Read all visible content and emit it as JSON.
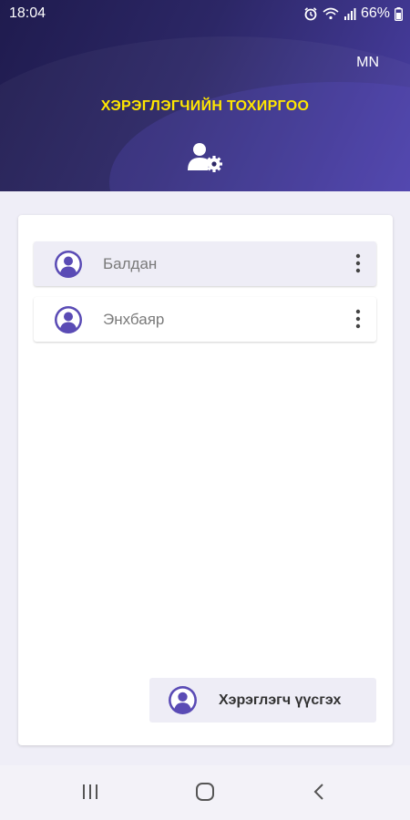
{
  "status": {
    "time": "18:04",
    "battery": "66%"
  },
  "header": {
    "language": "MN",
    "title": "ХЭРЭГЛЭГЧИЙН ТОХИРГОО"
  },
  "users": [
    {
      "name": "Балдан",
      "selected": true
    },
    {
      "name": "Энхбаяр",
      "selected": false
    }
  ],
  "actions": {
    "add_user_label": "Хэрэглэгч үүсгэх"
  },
  "colors": {
    "accent": "#5a4bb5",
    "title": "#ffe600",
    "header_dark": "#1f1b4e"
  }
}
